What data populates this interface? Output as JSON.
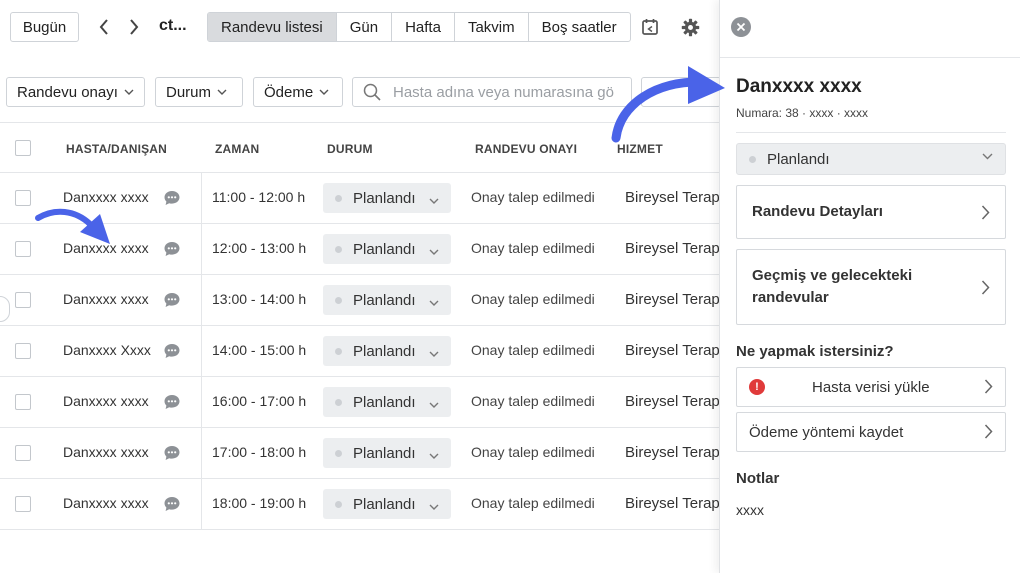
{
  "toolbar": {
    "today_label": "Bugün",
    "month_label": "ct...",
    "views": [
      "Randevu listesi",
      "Gün",
      "Hafta",
      "Takvim",
      "Boş saatler"
    ],
    "active_view": 0
  },
  "filters": {
    "approval_label": "Randevu onayı",
    "status_label": "Durum",
    "payment_label": "Ödeme",
    "search_placeholder": "Hasta adına veya numarasına gö"
  },
  "table": {
    "columns": [
      "HASTA/DANIŞAN",
      "ZAMAN",
      "DURUM",
      "RANDEVU ONAYI",
      "HIZMET"
    ],
    "rows": [
      {
        "name": "Danxxxx xxxx",
        "time": "11:00 - 12:00 h",
        "status": "Planlandı",
        "approval": "Onay talep edilmedi",
        "service": "Bireysel Terap"
      },
      {
        "name": "Danxxxx xxxx",
        "time": "12:00 - 13:00 h",
        "status": "Planlandı",
        "approval": "Onay talep edilmedi",
        "service": "Bireysel Terap"
      },
      {
        "name": "Danxxxx xxxx",
        "time": "13:00 - 14:00 h",
        "status": "Planlandı",
        "approval": "Onay talep edilmedi",
        "service": "Bireysel Terap"
      },
      {
        "name": "Danxxxx Xxxx",
        "time": "14:00 - 15:00 h",
        "status": "Planlandı",
        "approval": "Onay talep edilmedi",
        "service": "Bireysel Terap"
      },
      {
        "name": "Danxxxx xxxx",
        "time": "16:00 - 17:00 h",
        "status": "Planlandı",
        "approval": "Onay talep edilmedi",
        "service": "Bireysel Terap"
      },
      {
        "name": "Danxxxx xxxx",
        "time": "17:00 - 18:00 h",
        "status": "Planlandı",
        "approval": "Onay talep edilmedi",
        "service": "Bireysel Terap"
      },
      {
        "name": "Danxxxx xxxx",
        "time": "18:00 - 19:00 h",
        "status": "Planlandı",
        "approval": "Onay talep edilmedi",
        "service": "Bireysel Terap"
      }
    ]
  },
  "panel": {
    "patient_name": "Danxxxx xxxx",
    "patient_number": "Numara: 38 · xxxx · xxxx",
    "status": "Planlandı",
    "details_label": "Randevu Detayları",
    "history_label": "Geçmiş ve gelecekteki randevular",
    "actions_title": "Ne yapmak istersiniz?",
    "upload_label": "Hasta verisi yükle",
    "payment_method_label": "Ödeme yöntemi kaydet",
    "notes_title": "Notlar",
    "notes_text": "xxxx"
  },
  "colors": {
    "accent_arrow": "#4a63e8",
    "active_tab_bg": "#d9dbde",
    "warning": "#e03a3a"
  },
  "icons": [
    "chevron-left-icon",
    "chevron-right-icon",
    "calendar-export-icon",
    "gear-icon",
    "search-icon",
    "chat-bubble-icon",
    "chevron-down-icon",
    "close-icon",
    "warning-icon"
  ]
}
